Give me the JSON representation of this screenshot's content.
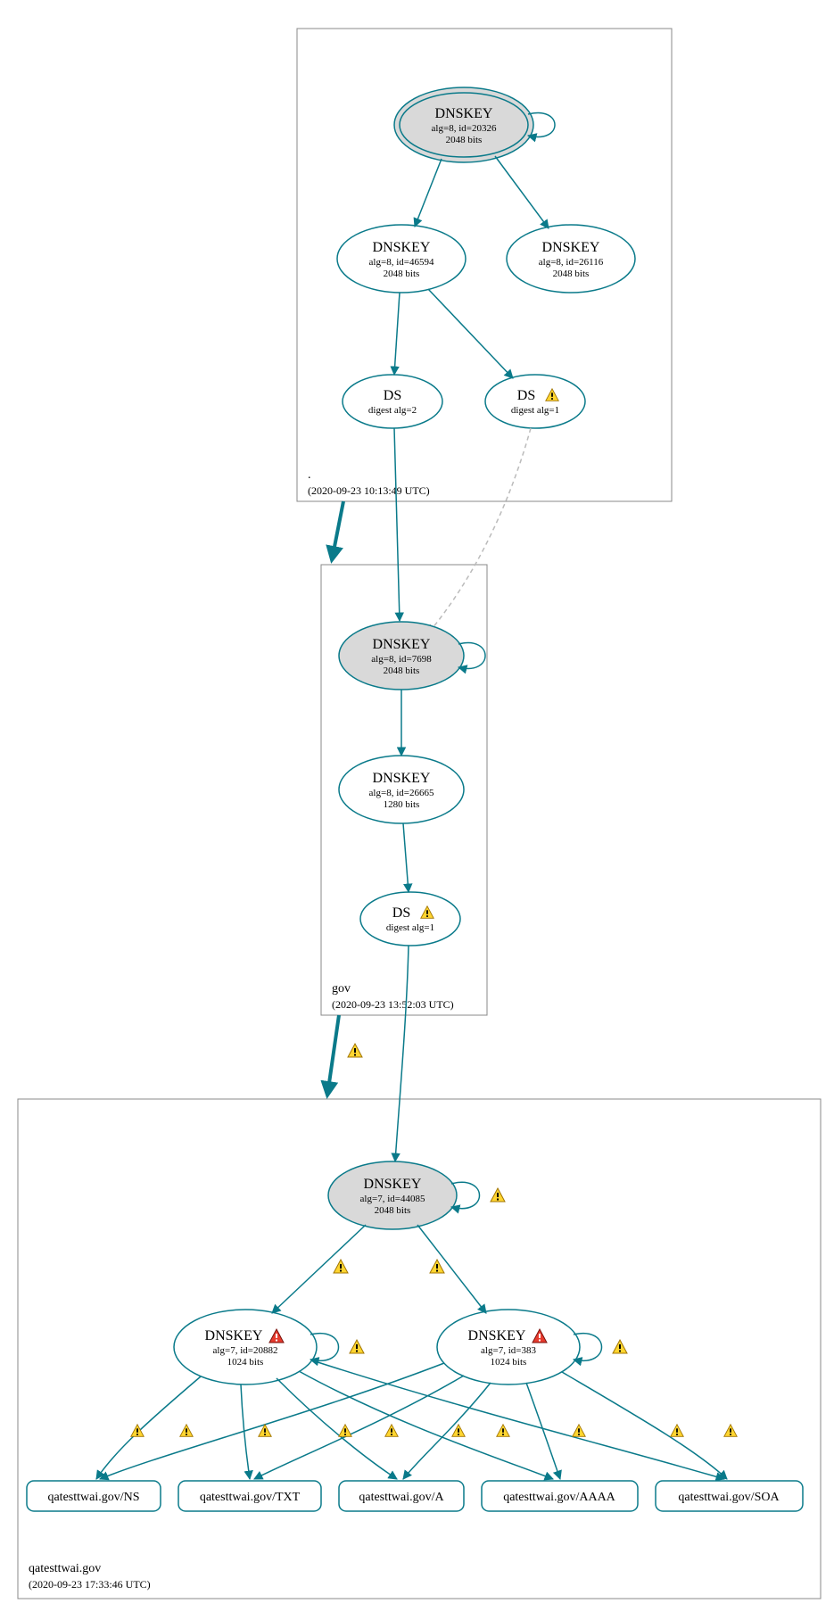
{
  "zones": {
    "root": {
      "name": ".",
      "timestamp": "(2020-09-23 10:13:49 UTC)"
    },
    "gov": {
      "name": "gov",
      "timestamp": "(2020-09-23 13:52:03 UTC)"
    },
    "leaf": {
      "name": "qatesttwai.gov",
      "timestamp": "(2020-09-23 17:33:46 UTC)"
    }
  },
  "nodes": {
    "root_ksk": {
      "title": "DNSKEY",
      "line1": "alg=8, id=20326",
      "line2": "2048 bits"
    },
    "root_zsk1": {
      "title": "DNSKEY",
      "line1": "alg=8, id=46594",
      "line2": "2048 bits"
    },
    "root_zsk2": {
      "title": "DNSKEY",
      "line1": "alg=8, id=26116",
      "line2": "2048 bits"
    },
    "root_ds1": {
      "title": "DS",
      "line1": "digest alg=2"
    },
    "root_ds2": {
      "title": "DS",
      "line1": "digest alg=1"
    },
    "gov_ksk": {
      "title": "DNSKEY",
      "line1": "alg=8, id=7698",
      "line2": "2048 bits"
    },
    "gov_zsk": {
      "title": "DNSKEY",
      "line1": "alg=8, id=26665",
      "line2": "1280 bits"
    },
    "gov_ds": {
      "title": "DS",
      "line1": "digest alg=1"
    },
    "leaf_ksk": {
      "title": "DNSKEY",
      "line1": "alg=7, id=44085",
      "line2": "2048 bits"
    },
    "leaf_zsk1": {
      "title": "DNSKEY",
      "line1": "alg=7, id=20882",
      "line2": "1024 bits"
    },
    "leaf_zsk2": {
      "title": "DNSKEY",
      "line1": "alg=7, id=383",
      "line2": "1024 bits"
    }
  },
  "rrsets": {
    "ns": "qatesttwai.gov/NS",
    "txt": "qatesttwai.gov/TXT",
    "a": "qatesttwai.gov/A",
    "aaaa": "qatesttwai.gov/AAAA",
    "soa": "qatesttwai.gov/SOA"
  }
}
